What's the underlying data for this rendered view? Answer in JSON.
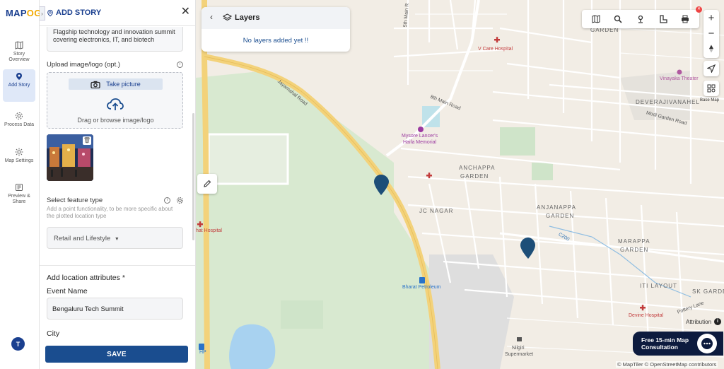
{
  "app": {
    "logo_text_a": "MAP",
    "logo_text_b": "OG",
    "user_initial": "T"
  },
  "rail": {
    "items": [
      {
        "label": "Story Overview",
        "icon": "map-icon"
      },
      {
        "label": "Add Story",
        "icon": "location-pin-icon",
        "active": true
      },
      {
        "label": "Process Data",
        "icon": "gear-icon"
      },
      {
        "label": "Map Settings",
        "icon": "settings-icon"
      },
      {
        "label": "Preview & Share",
        "icon": "preview-icon"
      }
    ]
  },
  "panel": {
    "title": "ADD STORY",
    "description_text": "Flagship technology and innovation summit covering electronics, IT, and biotech",
    "upload_label": "Upload image/logo (opt.)",
    "take_picture": "Take picture",
    "drag_text": "Drag or browse image/logo",
    "feature_type_label": "Select feature type",
    "feature_type_hint": "Add a point functionality, to be more specific about the plotted location type",
    "feature_type_value": "Retail and Lifestyle",
    "attributes_heading": "Add location attributes *",
    "event_name_label": "Event Name",
    "event_name_value": "Bengaluru Tech Summit",
    "city_label": "City",
    "save_label": "SAVE"
  },
  "layers": {
    "title": "Layers",
    "empty_text": "No layers added yet !!"
  },
  "map": {
    "areas": [
      "GARDEN",
      "DEVERAJIVANAHEL",
      "ANCHAPPA",
      "GARDEN",
      "JC NAGAR",
      "ANJANAPPA",
      "GARDEN",
      "MARAPPA",
      "GARDEN",
      "ITI LAYOUT",
      "SK GARDE"
    ],
    "roads": [
      "Jayamahal Road",
      "8th Main Road",
      "5th Main R",
      "Modi Garden Road",
      "C200",
      "Pottery Lane"
    ],
    "pois": {
      "v_care": "V Care Hospital",
      "mysore_1": "Mysore Lancer's",
      "mysore_2": "Haifa Memorial",
      "vinayaka": "Vinayaka Theater",
      "hat_hospital": "hat Hospital",
      "bharat": "Bharat Petroleum",
      "devine": "Devine Hospital",
      "nilgiri_1": "Nilgiri",
      "nilgiri_2": "Supermarket",
      "hp": "HP"
    },
    "base_map_label": "Base Map",
    "attribution_label": "Attribution",
    "copyright": "© MapTiler © OpenStreetMap contributors",
    "consult_line1": "Free 15-min Map",
    "consult_line2": "Consultation",
    "colors": {
      "marker": "#1d4e78",
      "park": "#d6ead2",
      "water": "#a8d2f0",
      "major_road": "#f3d27a"
    }
  }
}
